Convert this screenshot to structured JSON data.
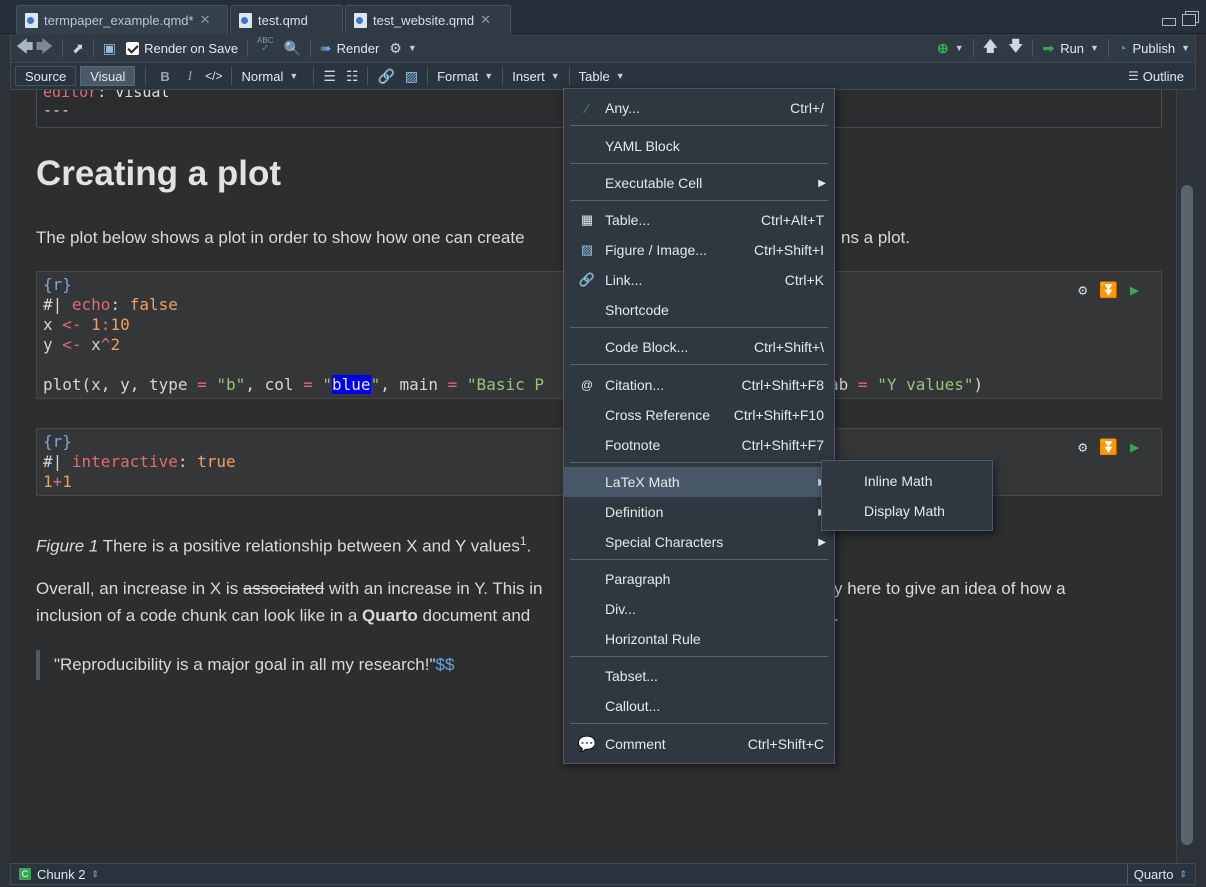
{
  "tabs": [
    {
      "label": "termpaper_example.qmd*",
      "active": true
    },
    {
      "label": "test.qmd",
      "active": false
    },
    {
      "label": "test_website.qmd",
      "active": false
    }
  ],
  "toolbar": {
    "render_on_save": "Render on Save",
    "render": "Render",
    "run": "Run",
    "publish": "Publish",
    "abc": "ABC"
  },
  "format_bar": {
    "source": "Source",
    "visual": "Visual",
    "bold": "B",
    "italic": "I",
    "code": "</>",
    "style": "Normal",
    "format": "Format",
    "insert": "Insert",
    "table": "Table",
    "outline": "Outline"
  },
  "document": {
    "yaml_key": "editor",
    "yaml_value": ": visual",
    "yaml_end": "---",
    "heading": "Creating a plot",
    "para1_left": "The plot below shows a plot in order to show how one can create",
    "para1_right": "ns a plot.",
    "chunk1": {
      "lang": "{r}",
      "opt_prefix": "#| ",
      "opt_key": "echo",
      "opt_sep": ": ",
      "opt_val": "false",
      "line_x_a": "x ",
      "line_x_op": "<-",
      "line_x_num1": " 1",
      "line_x_colon": ":",
      "line_x_num2": "10",
      "line_y_a": "y ",
      "line_y_op": "<-",
      "line_y_b": " x",
      "line_y_caret": "^",
      "line_y_num": "2",
      "plot_a": "plot(x, y, type ",
      "plot_eq1": "=",
      "plot_b": " ",
      "plot_s1": "\"b\"",
      "plot_c": ", col ",
      "plot_eq2": "=",
      "plot_d": " ",
      "plot_q1": "\"",
      "plot_sel": "blue",
      "plot_q2": "\"",
      "plot_e": ", main ",
      "plot_eq3": "=",
      "plot_f": " ",
      "plot_s3": "\"Basic P",
      "plot_g": "ab ",
      "plot_eq4": "=",
      "plot_h": " ",
      "plot_s4": "\"Y values\"",
      "plot_i": ")"
    },
    "chunk2": {
      "lang": "{r}",
      "opt_prefix": "#| ",
      "opt_key": "interactive",
      "opt_sep": ": ",
      "opt_val": "true",
      "expr_a": "1",
      "expr_op": "+",
      "expr_b": "1"
    },
    "caption_italic": "Figure 1",
    "caption_text": " There is a positive relationship between X and Y values",
    "caption_sup": "1",
    "caption_end": ".",
    "para2_line1_a": "Overall, an increase in X is ",
    "para2_strike": "associated",
    "para2_line1_b": " with an increase in Y. This in",
    "para2_line1_right": "y here to give an idea of how a",
    "para2_line2_a": "inclusion of a code chunk can look like in a ",
    "para2_bold": "Quarto",
    "para2_line2_b": " document and",
    "para2_line2_right": ".",
    "quote": "\"Reproducibility is a major goal in all my research!\"",
    "quote_math": "$$"
  },
  "insert_menu": [
    {
      "label": "Any...",
      "shortcut": "Ctrl+/",
      "icon": "wand-icon"
    },
    {
      "label": "YAML Block",
      "shortcut": "",
      "icon": ""
    },
    {
      "label": "Executable Cell",
      "shortcut": "",
      "icon": "",
      "submenu": true
    },
    {
      "label": "Table...",
      "shortcut": "Ctrl+Alt+T",
      "icon": "table-icon"
    },
    {
      "label": "Figure / Image...",
      "shortcut": "Ctrl+Shift+I",
      "icon": "image-icon"
    },
    {
      "label": "Link...",
      "shortcut": "Ctrl+K",
      "icon": "link-icon"
    },
    {
      "label": "Shortcode",
      "shortcut": "",
      "icon": ""
    },
    {
      "label": "Code Block...",
      "shortcut": "Ctrl+Shift+\\",
      "icon": ""
    },
    {
      "label": "Citation...",
      "shortcut": "Ctrl+Shift+F8",
      "icon": "at-icon"
    },
    {
      "label": "Cross Reference",
      "shortcut": "Ctrl+Shift+F10",
      "icon": ""
    },
    {
      "label": "Footnote",
      "shortcut": "Ctrl+Shift+F7",
      "icon": ""
    },
    {
      "label": "LaTeX Math",
      "shortcut": "",
      "icon": "",
      "submenu": true,
      "highlighted": true
    },
    {
      "label": "Definition",
      "shortcut": "",
      "icon": "",
      "submenu": true
    },
    {
      "label": "Special Characters",
      "shortcut": "",
      "icon": "",
      "submenu": true
    },
    {
      "label": "Paragraph",
      "shortcut": "",
      "icon": ""
    },
    {
      "label": "Div...",
      "shortcut": "",
      "icon": ""
    },
    {
      "label": "Horizontal Rule",
      "shortcut": "",
      "icon": ""
    },
    {
      "label": "Tabset...",
      "shortcut": "",
      "icon": ""
    },
    {
      "label": "Callout...",
      "shortcut": "",
      "icon": ""
    },
    {
      "label": "Comment",
      "shortcut": "Ctrl+Shift+C",
      "icon": "comment-icon"
    }
  ],
  "latex_submenu": [
    "Inline Math",
    "Display Math"
  ],
  "status": {
    "chunk": "Chunk 2",
    "chunk_badge": "C",
    "mode": "Quarto"
  },
  "colors": {
    "accent_green": "#3aa655",
    "selection_blue": "#0000e8",
    "menu_highlight": "#485868"
  }
}
